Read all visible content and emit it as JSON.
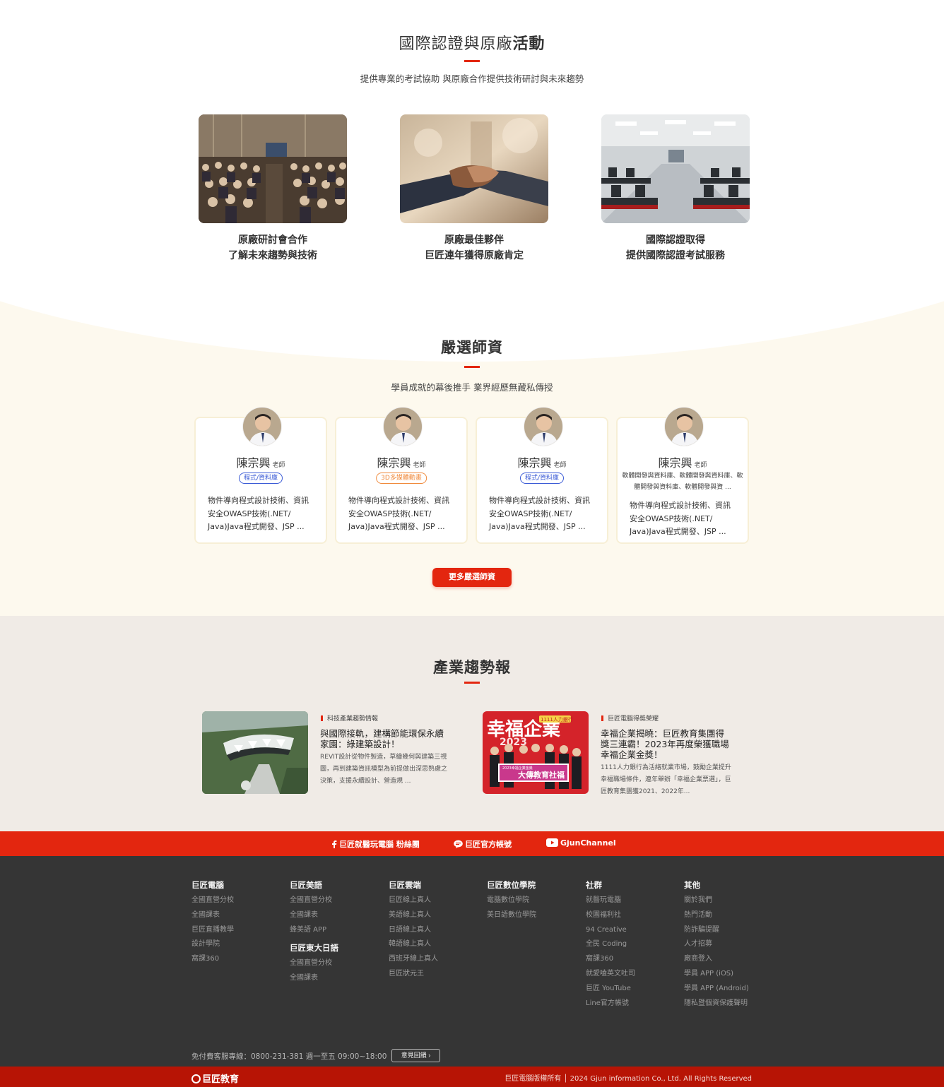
{
  "activities": {
    "title_normal": "國際認證與原廠",
    "title_bold": "活動",
    "subtitle": "提供專業的考試協助 與原廠合作提供技術研討與未來趨勢",
    "items": [
      {
        "line1": "原廠研討會合作",
        "line2": "了解未來趨勢與技術"
      },
      {
        "line1": "原廠最佳夥伴",
        "line2": "巨匠連年獲得原廠肯定"
      },
      {
        "line1": "國際認證取得",
        "line2": "提供國際認證考試服務"
      }
    ]
  },
  "teachers": {
    "title": "嚴選師資",
    "subtitle": "學員成就的幕後推手 業界經歷無藏私傳授",
    "honorific": "老師",
    "cards": [
      {
        "name": "陳宗興",
        "tag": "程式/資料庫",
        "desc": "物件導向程式設計技術、資訊安全OWASP技術(.NET/ Java)Java程式開發、JSP ..."
      },
      {
        "name": "陳宗興",
        "tag": "3D多媒體動畫",
        "desc": "物件導向程式設計技術、資訊安全OWASP技術(.NET/ Java)Java程式開發、JSP ..."
      },
      {
        "name": "陳宗興",
        "tag": "程式/資料庫",
        "desc": "物件導向程式設計技術、資訊安全OWASP技術(.NET/ Java)Java程式開發、JSP ..."
      },
      {
        "name": "陳宗興",
        "tag_text": "軟體開發與資料庫、軟體開發與資料庫、軟體開發與資料庫、軟體開發與資 ...",
        "desc": "物件導向程式設計技術、資訊安全OWASP技術(.NET/ Java)Java程式開發、JSP ..."
      }
    ],
    "more_button": "更多嚴選師資"
  },
  "trends": {
    "title": "產業趨勢報",
    "items": [
      {
        "category": "科技產業趨勢情報",
        "title": "與國際接軌，建構節能環保永續家園：綠建築設計！",
        "excerpt": "REVIT設計從物件製造，草繪幾何與建築三視圖，再到建築資訊模型為前提做出深思熟慮之決策，支援永續設計、營造規 ..."
      },
      {
        "category": "巨匠電腦得獎榮耀",
        "title": "幸福企業揭曉：巨匠教育集團得獎三連霸！2023年再度榮獲職場幸福企業金獎！",
        "excerpt": "1111人力銀行為活絡就業市場，鼓勵企業提升幸福職場條件，連年舉辦「幸福企業票選」，巨匠教育集團獲2021、2022年..."
      }
    ],
    "image_text": {
      "poster1": "幸福企業",
      "poster2": "2023",
      "banner": "1111人力銀行",
      "board": "大傳教育社福",
      "board_small": "2023幸福企業金獎"
    }
  },
  "social": {
    "facebook": "巨匠就醫玩電腦 粉絲團",
    "line": "巨匠官方帳號",
    "youtube": "GjunChannel"
  },
  "footer": {
    "columns": [
      {
        "title": "巨匠電腦",
        "links": [
          "全國直營分校",
          "全國課表",
          "巨匠直播教學",
          "設計學院",
          "窩課360"
        ]
      },
      {
        "title": "巨匠美語",
        "links": [
          "全國直營分校",
          "全國課表",
          "蜂美語 APP"
        ],
        "title2": "巨匠東大日語",
        "links2": [
          "全國直營分校",
          "全國課表"
        ]
      },
      {
        "title": "巨匠雲端",
        "links": [
          "巨匠線上真人",
          "美語線上真人",
          "日語線上真人",
          "韓語線上真人",
          "西班牙線上真人",
          "巨匠狀元王"
        ]
      },
      {
        "title": "巨匠數位學院",
        "links": [
          "電腦數位學院",
          "美日語數位學院"
        ]
      },
      {
        "title": "社群",
        "links": [
          "就醫玩電腦",
          "校園福利社",
          "94 Creative",
          "全民 Coding",
          "窩課360",
          "就愛嗑英文吐司",
          "巨匠 YouTube",
          "Line官方帳號"
        ]
      },
      {
        "title": "其他",
        "links": [
          "關於我們",
          "熱門活動",
          "防詐騙提醒",
          "人才招募",
          "廠商登入",
          "學員 APP (iOS)",
          "學員 APP (Android)",
          "隱私暨個資保護聲明"
        ]
      }
    ],
    "hotline": "免付費客服專線：0800-231-381  週一至五 09:00~18:00",
    "feedback_button": "意見回饋",
    "logo": "巨匠教育",
    "copyright": "巨匠電腦版權所有 │ 2024 Gjun information Co., Ltd. All Rights Reserved"
  },
  "colors": {
    "accent": "#e3260f",
    "cream": "#fdf9ee",
    "beige": "#f0ebe6",
    "footer": "#353535",
    "bottom": "#b71405"
  }
}
